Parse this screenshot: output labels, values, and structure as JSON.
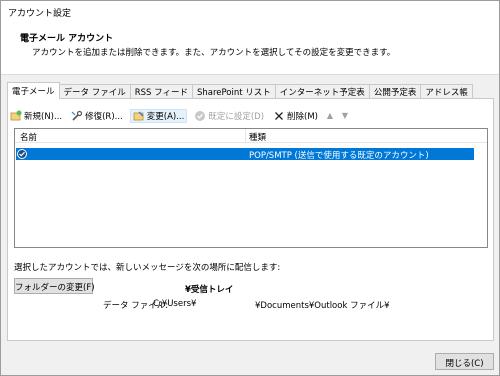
{
  "window": {
    "title": "アカウント設定"
  },
  "header": {
    "title": "電子メール アカウント",
    "description": "アカウントを追加または削除できます。また、アカウントを選択してその設定を変更できます。"
  },
  "tabs": [
    {
      "label": "電子メール",
      "active": true
    },
    {
      "label": "データ ファイル"
    },
    {
      "label": "RSS フィード"
    },
    {
      "label": "SharePoint リスト"
    },
    {
      "label": "インターネット予定表"
    },
    {
      "label": "公開予定表"
    },
    {
      "label": "アドレス帳"
    }
  ],
  "toolbar": {
    "new_label": "新規(N)...",
    "repair_label": "修復(R)...",
    "change_label": "変更(A)...",
    "default_label": "既定に設定(D)",
    "delete_label": "削除(M)"
  },
  "list": {
    "col_name": "名前",
    "col_type": "種類",
    "rows": [
      {
        "name": "",
        "type": "POP/SMTP (送信で使用する既定のアカウント)"
      }
    ]
  },
  "delivery": {
    "text": "選択したアカウントでは、新しいメッセージを次の場所に配信します:",
    "change_folder_label": "フォルダーの変更(F)",
    "inbox_label": "¥受信トレイ",
    "datafile_label": "データ ファイル:",
    "datafile_path": "C:¥Users¥",
    "datafile_path2": "¥Documents¥Outlook ファイル¥"
  },
  "footer": {
    "close_label": "閉じる(C)"
  },
  "colors": {
    "selection": "#0078d7",
    "background": "#f0f0f0"
  }
}
